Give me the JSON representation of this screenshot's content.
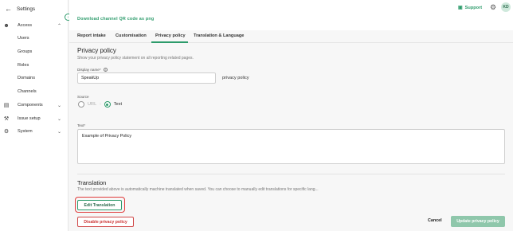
{
  "sidebar": {
    "back_icon": "arrow-left-icon",
    "title": "Settings",
    "sections": [
      {
        "label": "Access",
        "icon": "users-group-icon",
        "expanded": true,
        "items": [
          "Users",
          "Groups",
          "Roles",
          "Domains",
          "Channels"
        ]
      },
      {
        "label": "Components",
        "icon": "database-icon",
        "expanded": false
      },
      {
        "label": "Issue setup",
        "icon": "tools-icon",
        "expanded": false
      },
      {
        "label": "System",
        "icon": "gear-icon",
        "expanded": false
      }
    ]
  },
  "topbar": {
    "qr_link": "Download channel QR code as png",
    "support_label": "Support",
    "avatar_initials": "KD"
  },
  "tabs": [
    {
      "label": "Report intake",
      "active": false
    },
    {
      "label": "Customisation",
      "active": false
    },
    {
      "label": "Privacy policy",
      "active": true
    },
    {
      "label": "Translation & Language",
      "active": false
    }
  ],
  "privacy": {
    "title": "Privacy policy",
    "subtitle": "Show your privacy policy statement on all reporting related pages.",
    "display_name_label": "Display name*",
    "display_name_value": "SpeakUp",
    "display_name_suffix": "privacy policy",
    "source_label": "Source",
    "source_options": [
      "URL",
      "Text"
    ],
    "source_selected": "Text",
    "text_label": "Text*",
    "text_value": "Example of Privacy Policy"
  },
  "translation": {
    "title": "Translation",
    "subtitle": "The text provided above is automatically machine translated when saved. You can choose to manually edit translations for specific lang...",
    "edit_button": "Edit Translation"
  },
  "footer": {
    "disable_button": "Disable privacy policy",
    "cancel_button": "Cancel",
    "update_button": "Update privacy policy"
  },
  "colors": {
    "accent": "#2d9b6b",
    "danger": "#d04848",
    "highlight": "#e03b3b"
  }
}
